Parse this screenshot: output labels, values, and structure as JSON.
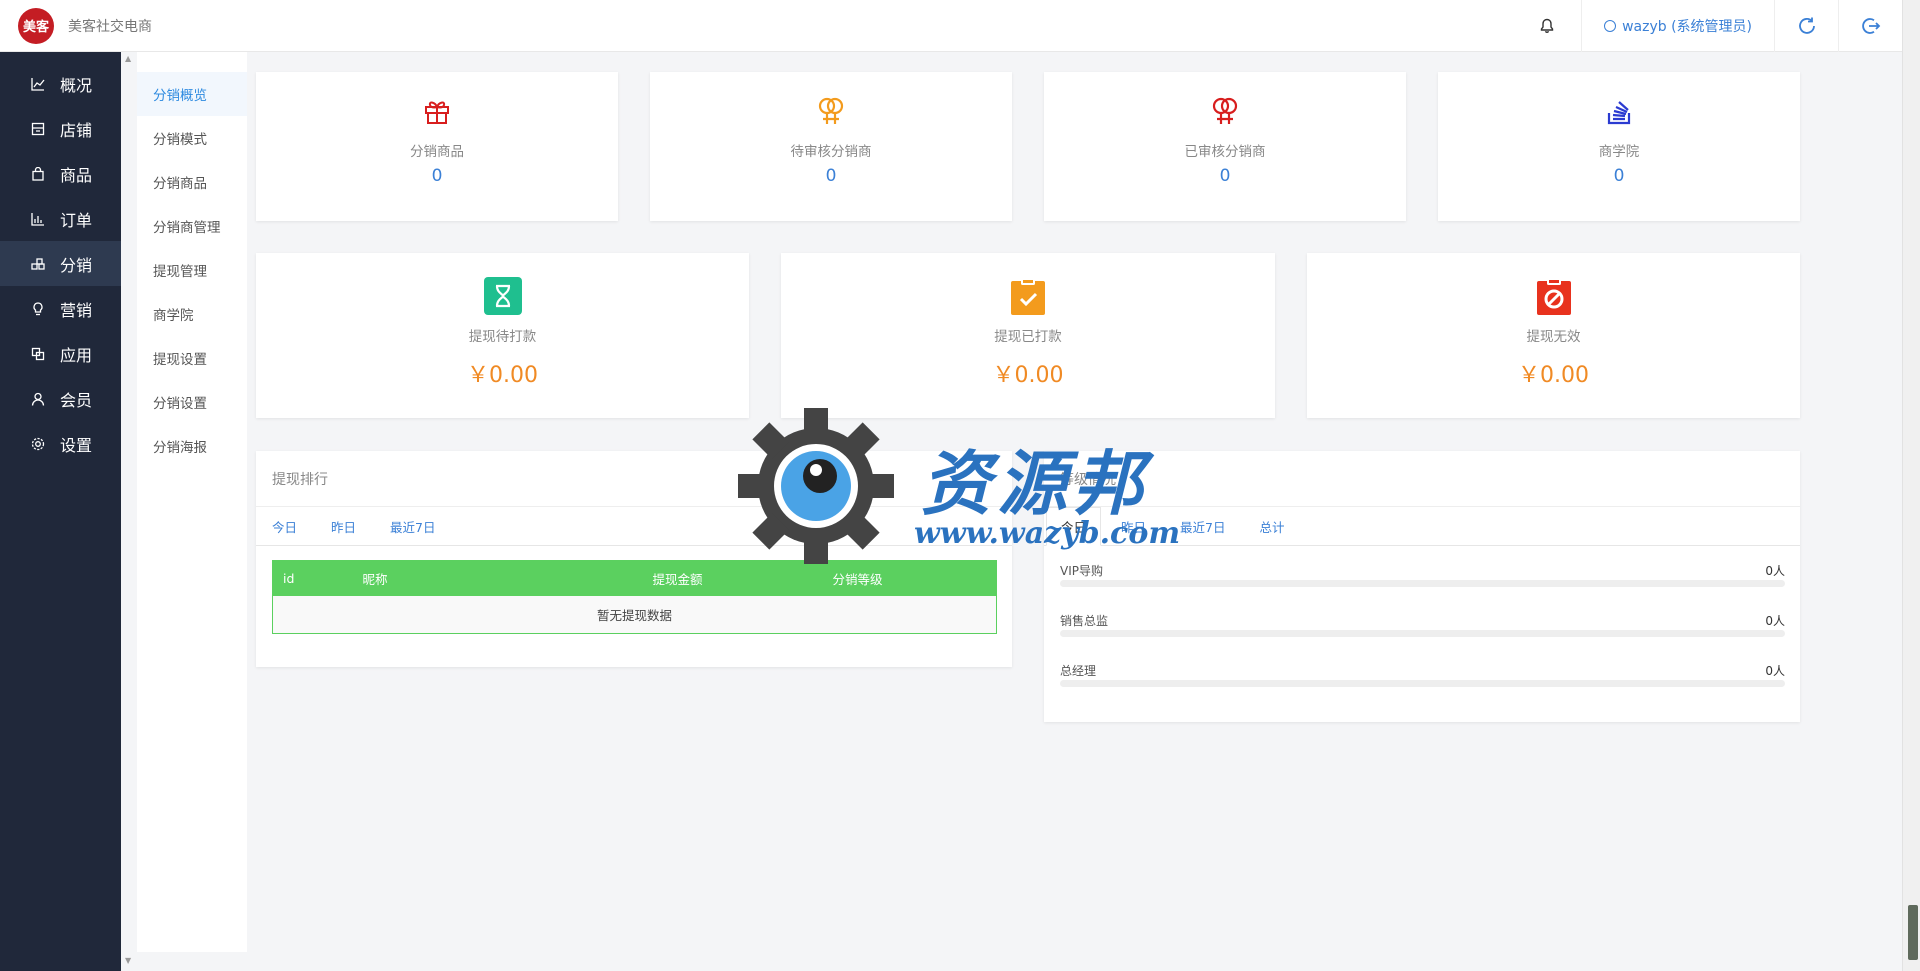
{
  "header": {
    "logo_text": "美客",
    "brand": "美客社交电商",
    "user": "wazyb (系统管理员)"
  },
  "sidebar": {
    "items": [
      {
        "label": "概况",
        "icon": "chart-line-icon"
      },
      {
        "label": "店铺",
        "icon": "store-icon"
      },
      {
        "label": "商品",
        "icon": "bag-icon"
      },
      {
        "label": "订单",
        "icon": "bar-chart-icon"
      },
      {
        "label": "分销",
        "icon": "distribution-icon"
      },
      {
        "label": "营销",
        "icon": "bulb-icon"
      },
      {
        "label": "应用",
        "icon": "apps-icon"
      },
      {
        "label": "会员",
        "icon": "user-icon"
      },
      {
        "label": "设置",
        "icon": "gear-icon"
      }
    ]
  },
  "subnav": {
    "items": [
      "分销概览",
      "分销模式",
      "分销商品",
      "分销商管理",
      "提现管理",
      "商学院",
      "提现设置",
      "分销设置",
      "分销海报"
    ]
  },
  "stats_top": [
    {
      "label": "分销商品",
      "value": "0",
      "color": "#d81e1e"
    },
    {
      "label": "待审核分销商",
      "value": "0",
      "color": "#f39b1d"
    },
    {
      "label": "已审核分销商",
      "value": "0",
      "color": "#d81e1e"
    },
    {
      "label": "商学院",
      "value": "0",
      "color": "#2b3bd1"
    }
  ],
  "stats_money": [
    {
      "label": "提现待打款",
      "value": "￥0.00",
      "color": "#1fbf8f"
    },
    {
      "label": "提现已打款",
      "value": "￥0.00",
      "color": "#f39b1d"
    },
    {
      "label": "提现无效",
      "value": "￥0.00",
      "color": "#e8321e"
    }
  ],
  "rank": {
    "title": "提现排行",
    "tabs": [
      "今日",
      "昨日",
      "最近7日"
    ],
    "columns": [
      "id",
      "昵称",
      "提现金额",
      "分销等级"
    ],
    "empty": "暂无提现数据"
  },
  "level": {
    "title": "等级情况",
    "tabs": [
      "今日",
      "昨日",
      "最近7日",
      "总计"
    ],
    "rows": [
      {
        "name": "VIP导购",
        "value": "0人"
      },
      {
        "name": "销售总监",
        "value": "0人"
      },
      {
        "name": "总经理",
        "value": "0人"
      }
    ]
  },
  "watermark": {
    "text": "资源邦",
    "url": "www.wazyb.com"
  }
}
